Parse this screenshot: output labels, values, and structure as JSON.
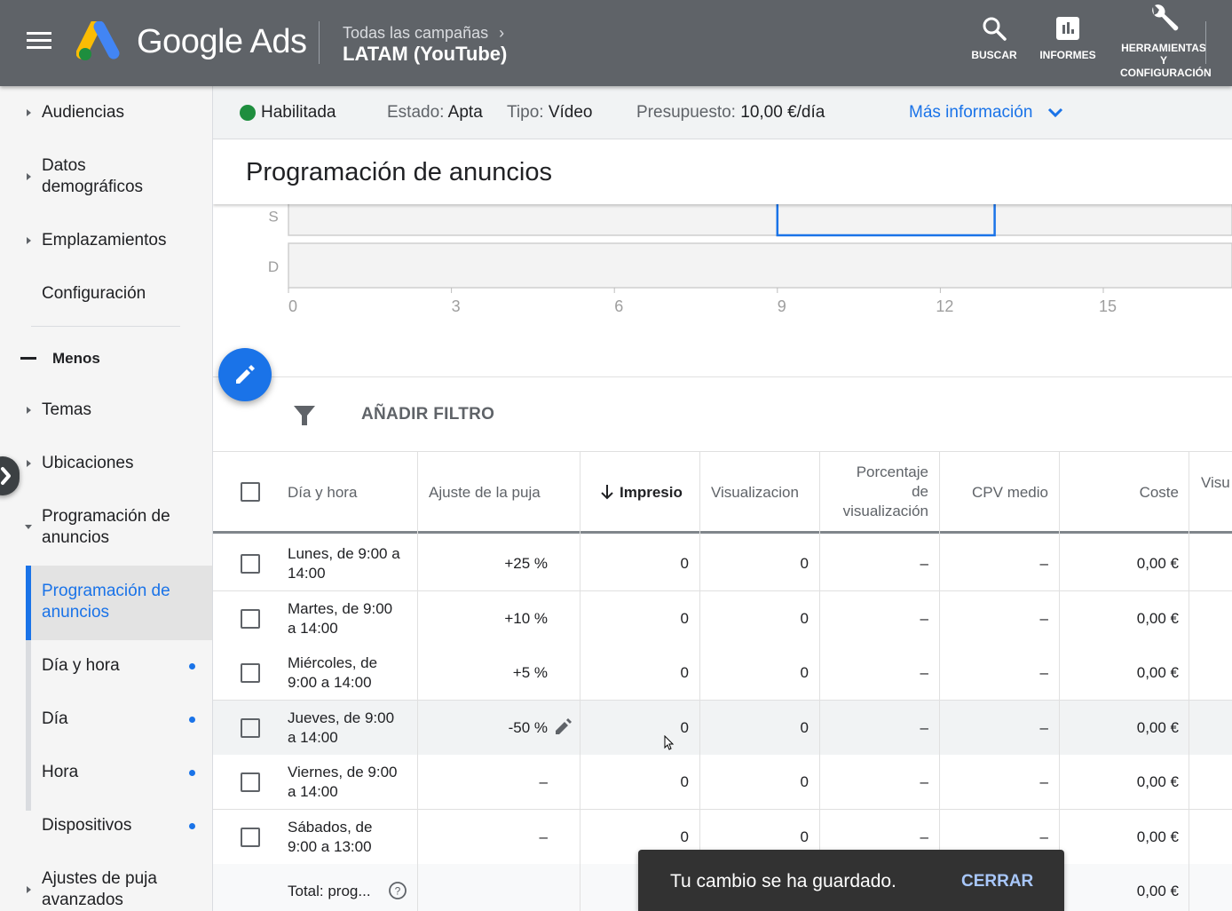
{
  "topbar": {
    "brand": "Google Ads",
    "breadcrumb_parent": "Todas las campañas",
    "breadcrumb_chevron": "›",
    "campaign_title": "LATAM (YouTube)",
    "actions": [
      {
        "label": "BUSCAR",
        "icon": "search-icon"
      },
      {
        "label": "INFORMES",
        "icon": "reports-icon"
      },
      {
        "label": "HERRAMIENTAS\nY\nCONFIGURACIÓN",
        "label_lines": [
          "HERRAMIENTAS",
          "Y",
          "CONFIGURACIÓN"
        ],
        "icon": "wrench-icon"
      }
    ]
  },
  "sidebar": {
    "items": [
      {
        "label": "Audiencias",
        "caret": "right"
      },
      {
        "label": "Datos demográficos",
        "lines": [
          "Datos",
          "demográficos"
        ],
        "caret": "right"
      },
      {
        "label": "Emplazamientos",
        "caret": "right"
      },
      {
        "label": "Configuración",
        "caret": "none"
      }
    ],
    "toggle_label": "Menos",
    "more_items": [
      {
        "label": "Temas",
        "caret": "right"
      },
      {
        "label": "Ubicaciones",
        "caret": "right"
      },
      {
        "label": "Programación de anuncios",
        "lines": [
          "Programación de",
          "anuncios"
        ],
        "caret": "down"
      }
    ],
    "sub_items": [
      {
        "label": "Programación de anuncios",
        "lines": [
          "Programación de",
          "anuncios"
        ],
        "active": true
      },
      {
        "label": "Día y hora",
        "dot": true
      },
      {
        "label": "Día",
        "dot": true
      },
      {
        "label": "Hora",
        "dot": true
      }
    ],
    "after_items": [
      {
        "label": "Dispositivos",
        "dot": true,
        "caret": "none"
      },
      {
        "label": "Ajustes de puja avanzados",
        "lines": [
          "Ajustes de puja",
          "avanzados"
        ],
        "caret": "right"
      }
    ]
  },
  "status": {
    "state_label": "Habilitada",
    "state_color": "#1e8e3e",
    "estado_key": "Estado:",
    "estado_value": "Apta",
    "tipo_key": "Tipo:",
    "tipo_value": "Vídeo",
    "presupuesto_key": "Presupuesto:",
    "presupuesto_value": "10,00 €/día",
    "more_info": "Más información"
  },
  "page": {
    "title": "Programación de anuncios"
  },
  "chart_data": {
    "type": "heatmap",
    "title": "",
    "rows_visible": [
      "S",
      "D"
    ],
    "x_ticks": [
      0,
      3,
      6,
      9,
      12,
      15
    ],
    "x_range": [
      0,
      18
    ],
    "highlighted_blocks": [
      {
        "row": "S",
        "start_hour": 9,
        "end_hour": 13
      }
    ],
    "accent_color": "#1a73e8"
  },
  "filter": {
    "label": "AÑADIR FILTRO"
  },
  "table": {
    "columns": [
      {
        "label": "Día y hora"
      },
      {
        "label": "Ajuste de la puja"
      },
      {
        "label": "Impresiones",
        "display": "Impresio",
        "sorted": "desc"
      },
      {
        "label": "Visualizaciones",
        "display": "Visualizacion"
      },
      {
        "label": "Porcentaje de visualización",
        "lines": [
          "Porcentaje",
          "de",
          "visualización"
        ]
      },
      {
        "label": "CPV medio"
      },
      {
        "label": "Coste"
      },
      {
        "label": "Visu"
      }
    ],
    "rows": [
      {
        "day_line1": "Lunes, de 9:00 a",
        "day_line2": "14:00",
        "bid": "+25 %",
        "impressions": "0",
        "views": "0",
        "view_rate": "–",
        "cpv": "–",
        "cost": "0,00 €"
      },
      {
        "day_line1": "Martes, de 9:00",
        "day_line2": "a 14:00",
        "bid": "+10 %",
        "impressions": "0",
        "views": "0",
        "view_rate": "–",
        "cpv": "–",
        "cost": "0,00 €"
      },
      {
        "day_line1": "Miércoles, de",
        "day_line2": "9:00 a 14:00",
        "bid": "+5 %",
        "impressions": "0",
        "views": "0",
        "view_rate": "–",
        "cpv": "–",
        "cost": "0,00 €"
      },
      {
        "day_line1": "Jueves, de 9:00",
        "day_line2": "a 14:00",
        "bid": "-50 %",
        "impressions": "0",
        "views": "0",
        "view_rate": "–",
        "cpv": "–",
        "cost": "0,00 €",
        "hover": true
      },
      {
        "day_line1": "Viernes, de 9:00",
        "day_line2": "a 14:00",
        "bid": "–",
        "impressions": "0",
        "views": "0",
        "view_rate": "–",
        "cpv": "–",
        "cost": "0,00 €"
      },
      {
        "day_line1": "Sábados, de",
        "day_line2": "9:00 a 13:00",
        "bid": "–",
        "impressions": "0",
        "views": "0",
        "view_rate": "–",
        "cpv": "–",
        "cost": "0,00 €"
      }
    ],
    "total": {
      "label": "Total: prog...",
      "cost": "0,00 €"
    }
  },
  "snackbar": {
    "message": "Tu cambio se ha guardado.",
    "action": "CERRAR"
  }
}
